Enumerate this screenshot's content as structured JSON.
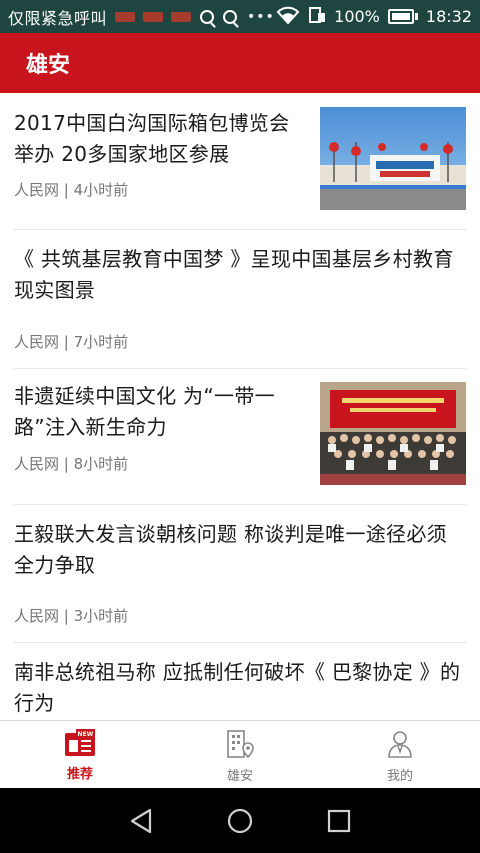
{
  "status_bar": {
    "carrier": "仅限紧急呼叫",
    "battery": "100%",
    "time": "18:32"
  },
  "header": {
    "title": "雄安"
  },
  "news": [
    {
      "title": "2017中国白沟国际箱包博览会举办 20多国家地区参展",
      "meta": "人民网 | 4小时前",
      "thumb": "expo-photo"
    },
    {
      "title": "《 共筑基层教育中国梦 》呈现中国基层乡村教育现实图景",
      "meta": "人民网 | 7小时前"
    },
    {
      "title": "非遗延续中国文化 为“一带一路”注入新生命力",
      "meta": "人民网 | 8小时前",
      "thumb": "group-photo"
    },
    {
      "title": "王毅联大发言谈朝核问题 称谈判是唯一途径必须全力争取",
      "meta": "人民网 | 3小时前"
    },
    {
      "title": "南非总统祖马称 应抵制任何破坏《 巴黎协定 》的行为"
    }
  ],
  "tabs": [
    {
      "label": "推荐",
      "icon": "news-icon",
      "active": true
    },
    {
      "label": "雄安",
      "icon": "city-location-icon",
      "active": false
    },
    {
      "label": "我的",
      "icon": "profile-icon",
      "active": false
    }
  ],
  "colors": {
    "brand_red": "#c8151d",
    "status_bar": "#1f4541",
    "meta_gray": "#777777"
  }
}
